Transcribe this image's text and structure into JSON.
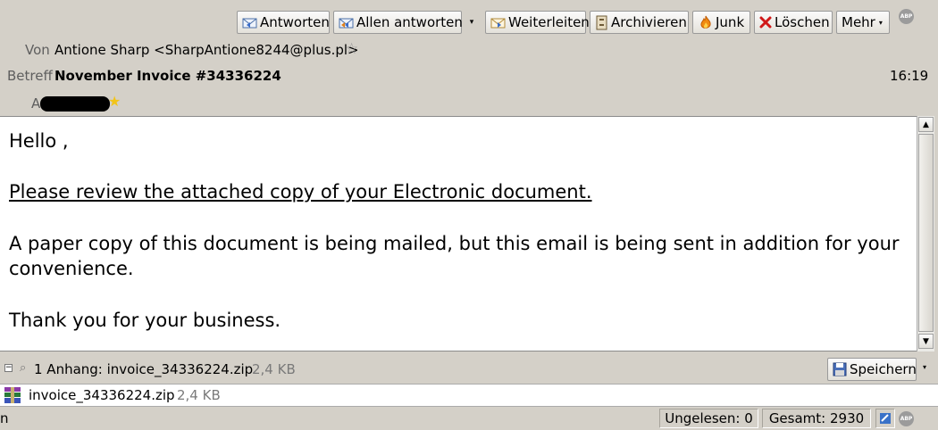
{
  "toolbar": {
    "reply": "Antworten",
    "reply_all": "Allen antworten",
    "forward": "Weiterleiten",
    "archive": "Archivieren",
    "junk": "Junk",
    "delete": "Löschen",
    "more": "Mehr"
  },
  "abp_label": "ABP",
  "header": {
    "from_label": "Von",
    "from_value": "Antione Sharp <SharpAntione8244@plus.pl>",
    "subject_label": "Betreff",
    "subject_value": "November Invoice #34336224",
    "time": "16:19",
    "to_label": "A"
  },
  "body": {
    "greeting": "Hello ,",
    "link_text": "Please review the attached copy of your Electronic document.",
    "paragraph_line1": "A paper copy of this document is being mailed, but this email is being sent in addition for your",
    "paragraph_line2": "convenience.",
    "closing": "Thank you for your business."
  },
  "attachments": {
    "summary": "1 Anhang: invoice_34336224.zip",
    "summary_size": "2,4 KB",
    "save_label": "Speichern",
    "items": [
      {
        "name": "invoice_34336224.zip",
        "size": "2,4 KB"
      }
    ]
  },
  "status": {
    "left_text": "n",
    "unread": "Ungelesen: 0",
    "total": "Gesamt: 2930"
  }
}
